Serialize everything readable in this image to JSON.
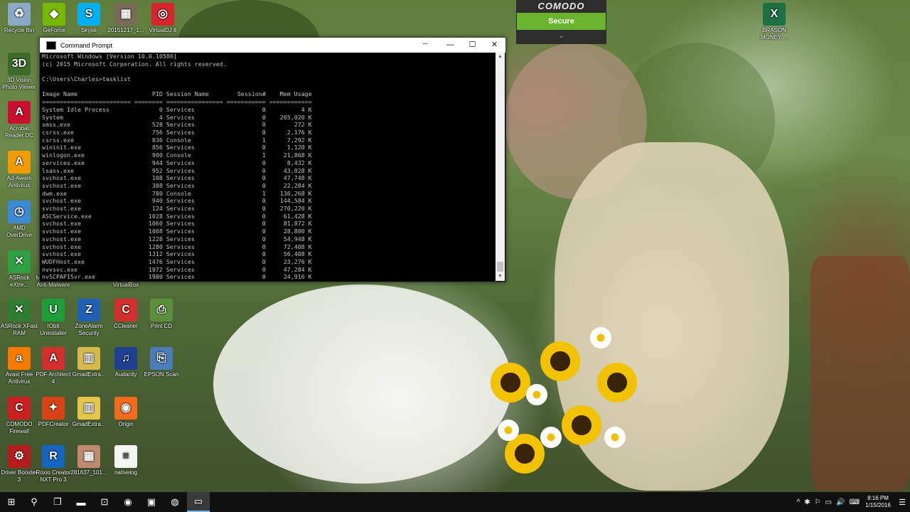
{
  "desktop_icons": [
    {
      "label": "Recycle Bin",
      "icon": "recycle-bin-icon",
      "color": "#8aa9c9",
      "glyph": "♻"
    },
    {
      "label": "GeForce",
      "icon": "geforce-icon",
      "color": "#76b900",
      "glyph": "◆"
    },
    {
      "label": "Skype",
      "icon": "skype-icon",
      "color": "#00aff0",
      "glyph": "S"
    },
    {
      "label": "20151217_1...",
      "icon": "photo-thumbnail-icon",
      "color": "#7a6a58",
      "glyph": "▦"
    },
    {
      "label": "VirtualDJ 8",
      "icon": "virtualdj-icon",
      "color": "#d9232e",
      "glyph": "◎"
    },
    {
      "label": "3D Vision Photo Viewer",
      "icon": "3d-vision-icon",
      "color": "#3c6b2a",
      "glyph": "3D"
    },
    {
      "label": "Acrobat Reader DC",
      "icon": "acrobat-icon",
      "color": "#c8102e",
      "glyph": "A"
    },
    {
      "label": "Ad-Aware Antivirus",
      "icon": "ad-aware-icon",
      "color": "#f29b00",
      "glyph": "A"
    },
    {
      "label": "AMD OverDrive",
      "icon": "amd-overdrive-icon",
      "color": "#3b8ad9",
      "glyph": "◷"
    },
    {
      "label": "ASRock eXtre...",
      "icon": "asrock-extreme-icon",
      "color": "#2ea043",
      "glyph": "✕"
    },
    {
      "label": "Malwarebytes Anti-Malware",
      "icon": "malwarebytes-icon",
      "color": "#2d6db5",
      "glyph": "M"
    },
    {
      "label": "Oracle VM VirtualBox",
      "icon": "virtualbox-icon",
      "color": "#1a5fa0",
      "glyph": "▣"
    },
    {
      "label": "ASRock XFast RAM",
      "icon": "asrock-xfast-icon",
      "color": "#2e7d32",
      "glyph": "✕"
    },
    {
      "label": "IObit Uninstaller",
      "icon": "iobit-icon",
      "color": "#1f9d3a",
      "glyph": "U"
    },
    {
      "label": "ZoneAlarm Security",
      "icon": "zonealarm-icon",
      "color": "#1f5fb5",
      "glyph": "Z"
    },
    {
      "label": "CCleaner",
      "icon": "ccleaner-icon",
      "color": "#d32f2f",
      "glyph": "C"
    },
    {
      "label": "Print CD",
      "icon": "printcd-icon",
      "color": "#5a8f3c",
      "glyph": "⎙"
    },
    {
      "label": "Avast Free Antivirus",
      "icon": "avast-icon",
      "color": "#f57c00",
      "glyph": "a"
    },
    {
      "label": "PDF Architect 4",
      "icon": "pdf-architect-icon",
      "color": "#d32f2f",
      "glyph": "A"
    },
    {
      "label": "GmadExtra...",
      "icon": "archive-icon",
      "color": "#d8b84a",
      "glyph": "▥"
    },
    {
      "label": "Audacity",
      "icon": "audacity-icon",
      "color": "#1f3f8f",
      "glyph": "♫"
    },
    {
      "label": "EPSON Scan",
      "icon": "epson-scan-icon",
      "color": "#4b7bb8",
      "glyph": "⎘"
    },
    {
      "label": "COMODO Firewall",
      "icon": "comodo-firewall-icon",
      "color": "#cc1f1f",
      "glyph": "C"
    },
    {
      "label": "PDFCreator",
      "icon": "pdfcreator-icon",
      "color": "#d84315",
      "glyph": "✦"
    },
    {
      "label": "GmadExtra...",
      "icon": "archive-icon",
      "color": "#e6c64a",
      "glyph": "▥"
    },
    {
      "label": "Origin",
      "icon": "origin-icon",
      "color": "#f26b1d",
      "glyph": "◉"
    },
    {
      "label": "Driver Booster 3",
      "icon": "driver-booster-icon",
      "color": "#b71c1c",
      "glyph": "⚙"
    },
    {
      "label": "Roxio Creator NXT Pro 3",
      "icon": "roxio-icon",
      "color": "#1565c0",
      "glyph": "R"
    },
    {
      "label": "281637_101...",
      "icon": "photo-thumbnail-icon",
      "color": "#c08a70",
      "glyph": "▦"
    },
    {
      "label": "nativelog",
      "icon": "text-file-icon",
      "color": "#f4f4f4",
      "glyph": "≡"
    },
    {
      "label": "BRASON MONEY ...",
      "icon": "excel-file-icon",
      "color": "#1d7044",
      "glyph": "X"
    }
  ],
  "comodo": {
    "brand": "COMODO",
    "status": "Secure",
    "expand": "⌄"
  },
  "cmd": {
    "title": "Command Prompt",
    "buttons": {
      "minimize": "—",
      "maximize": "☐",
      "close": "✕"
    },
    "resize_glyph": "↔",
    "header_lines": [
      "Microsoft Windows [Version 10.0.10586]",
      "(c) 2015 Microsoft Corporation. All rights reserved.",
      "",
      "C:\\Users\\Charles>tasklist",
      "",
      "Image Name                     PID Session Name        Session#    Mem Usage",
      "========================= ======== ================ =========== ============"
    ],
    "processes": [
      {
        "name": "System Idle Process",
        "pid": "0",
        "session": "Services",
        "num": "0",
        "mem": "4 K"
      },
      {
        "name": "System",
        "pid": "4",
        "session": "Services",
        "num": "0",
        "mem": "265,020 K"
      },
      {
        "name": "smss.exe",
        "pid": "528",
        "session": "Services",
        "num": "0",
        "mem": "272 K"
      },
      {
        "name": "csrss.exe",
        "pid": "756",
        "session": "Services",
        "num": "0",
        "mem": "2,176 K"
      },
      {
        "name": "csrss.exe",
        "pid": "836",
        "session": "Console",
        "num": "1",
        "mem": "7,292 K"
      },
      {
        "name": "wininit.exe",
        "pid": "856",
        "session": "Services",
        "num": "0",
        "mem": "1,120 K"
      },
      {
        "name": "winlogon.exe",
        "pid": "900",
        "session": "Console",
        "num": "1",
        "mem": "21,868 K"
      },
      {
        "name": "services.exe",
        "pid": "944",
        "session": "Services",
        "num": "0",
        "mem": "8,432 K"
      },
      {
        "name": "lsass.exe",
        "pid": "952",
        "session": "Services",
        "num": "0",
        "mem": "43,028 K"
      },
      {
        "name": "svchost.exe",
        "pid": "108",
        "session": "Services",
        "num": "0",
        "mem": "47,748 K"
      },
      {
        "name": "svchost.exe",
        "pid": "388",
        "session": "Services",
        "num": "0",
        "mem": "22,284 K"
      },
      {
        "name": "dwm.exe",
        "pid": "780",
        "session": "Console",
        "num": "1",
        "mem": "136,268 K"
      },
      {
        "name": "svchost.exe",
        "pid": "940",
        "session": "Services",
        "num": "0",
        "mem": "144,584 K"
      },
      {
        "name": "svchost.exe",
        "pid": "124",
        "session": "Services",
        "num": "0",
        "mem": "270,220 K"
      },
      {
        "name": "ASCService.exe",
        "pid": "1028",
        "session": "Services",
        "num": "0",
        "mem": "61,428 K"
      },
      {
        "name": "svchost.exe",
        "pid": "1060",
        "session": "Services",
        "num": "0",
        "mem": "81,872 K"
      },
      {
        "name": "svchost.exe",
        "pid": "1068",
        "session": "Services",
        "num": "0",
        "mem": "28,800 K"
      },
      {
        "name": "svchost.exe",
        "pid": "1228",
        "session": "Services",
        "num": "0",
        "mem": "54,948 K"
      },
      {
        "name": "svchost.exe",
        "pid": "1280",
        "session": "Services",
        "num": "0",
        "mem": "72,408 K"
      },
      {
        "name": "svchost.exe",
        "pid": "1312",
        "session": "Services",
        "num": "0",
        "mem": "56,408 K"
      },
      {
        "name": "WUDFHost.exe",
        "pid": "1476",
        "session": "Services",
        "num": "0",
        "mem": "23,276 K"
      },
      {
        "name": "nvvsvc.exe",
        "pid": "1972",
        "session": "Services",
        "num": "0",
        "mem": "47,284 K"
      },
      {
        "name": "nvSCPAPISvr.exe",
        "pid": "1980",
        "session": "Services",
        "num": "0",
        "mem": "24,916 K"
      }
    ]
  },
  "taskbar": {
    "start": "⊞",
    "items": [
      {
        "name": "search-button",
        "glyph": "⚲"
      },
      {
        "name": "task-view-button",
        "glyph": "❐"
      },
      {
        "name": "file-explorer-button",
        "glyph": "▬"
      },
      {
        "name": "store-button",
        "glyph": "⊡"
      },
      {
        "name": "chrome-button",
        "glyph": "◉"
      },
      {
        "name": "app-button",
        "glyph": "▣"
      },
      {
        "name": "steam-button",
        "glyph": "◍"
      },
      {
        "name": "command-prompt-taskbar-button",
        "glyph": "▭"
      }
    ],
    "tray_icons": [
      "^",
      "✱",
      "⚐",
      "▭",
      "🔊",
      "⌨"
    ],
    "time": "8:16 PM",
    "date": "1/15/2016",
    "notification": "☰"
  }
}
